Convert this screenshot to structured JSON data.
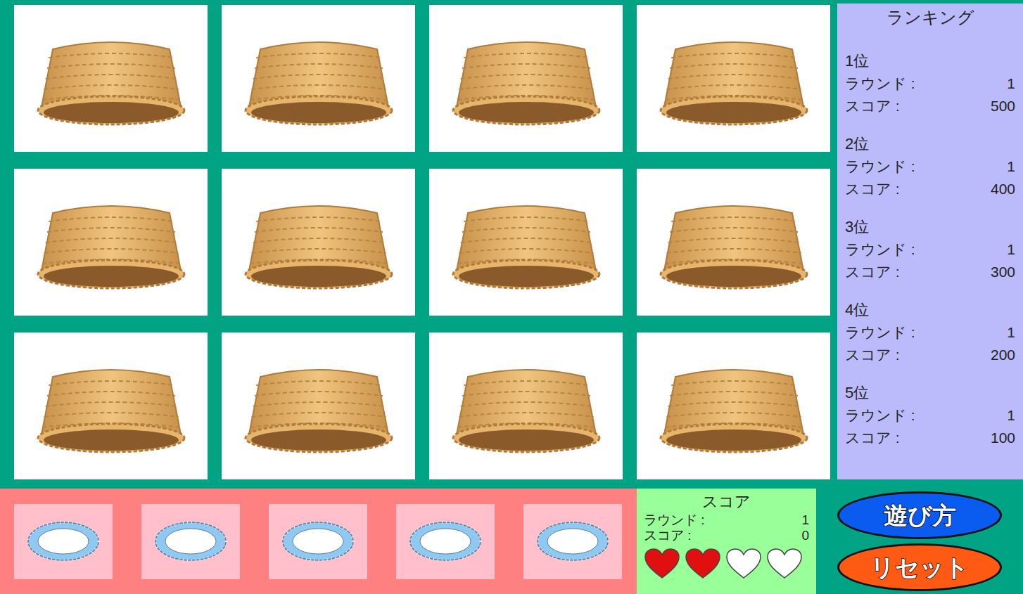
{
  "cards": [
    {
      "revealed": false
    },
    {
      "revealed": false
    },
    {
      "revealed": false
    },
    {
      "revealed": false
    },
    {
      "revealed": false
    },
    {
      "revealed": false
    },
    {
      "revealed": false
    },
    {
      "revealed": false
    },
    {
      "revealed": false
    },
    {
      "revealed": false
    },
    {
      "revealed": false
    },
    {
      "revealed": false
    }
  ],
  "ranking": {
    "title": "ランキング",
    "entries": [
      {
        "rank": "1位",
        "round_label": "ラウンド :",
        "round": "1",
        "score_label": "スコア :",
        "score": "500"
      },
      {
        "rank": "2位",
        "round_label": "ラウンド :",
        "round": "1",
        "score_label": "スコア :",
        "score": "400"
      },
      {
        "rank": "3位",
        "round_label": "ラウンド :",
        "round": "1",
        "score_label": "スコア :",
        "score": "300"
      },
      {
        "rank": "4位",
        "round_label": "ラウンド :",
        "round": "1",
        "score_label": "スコア :",
        "score": "200"
      },
      {
        "rank": "5位",
        "round_label": "ラウンド :",
        "round": "1",
        "score_label": "スコア :",
        "score": "100"
      }
    ]
  },
  "plates": [
    {
      "empty": true
    },
    {
      "empty": true
    },
    {
      "empty": true
    },
    {
      "empty": true
    },
    {
      "empty": true
    }
  ],
  "score": {
    "title": "スコア",
    "round_label": "ラウンド :",
    "round": "1",
    "score_label": "スコア :",
    "score": "0",
    "lives": [
      {
        "filled": true
      },
      {
        "filled": true
      },
      {
        "filled": false
      },
      {
        "filled": false
      }
    ]
  },
  "buttons": [
    {
      "label": "遊び方",
      "color": "#0a5cf0"
    },
    {
      "label": "リセット",
      "color": "#ff5a14"
    }
  ]
}
